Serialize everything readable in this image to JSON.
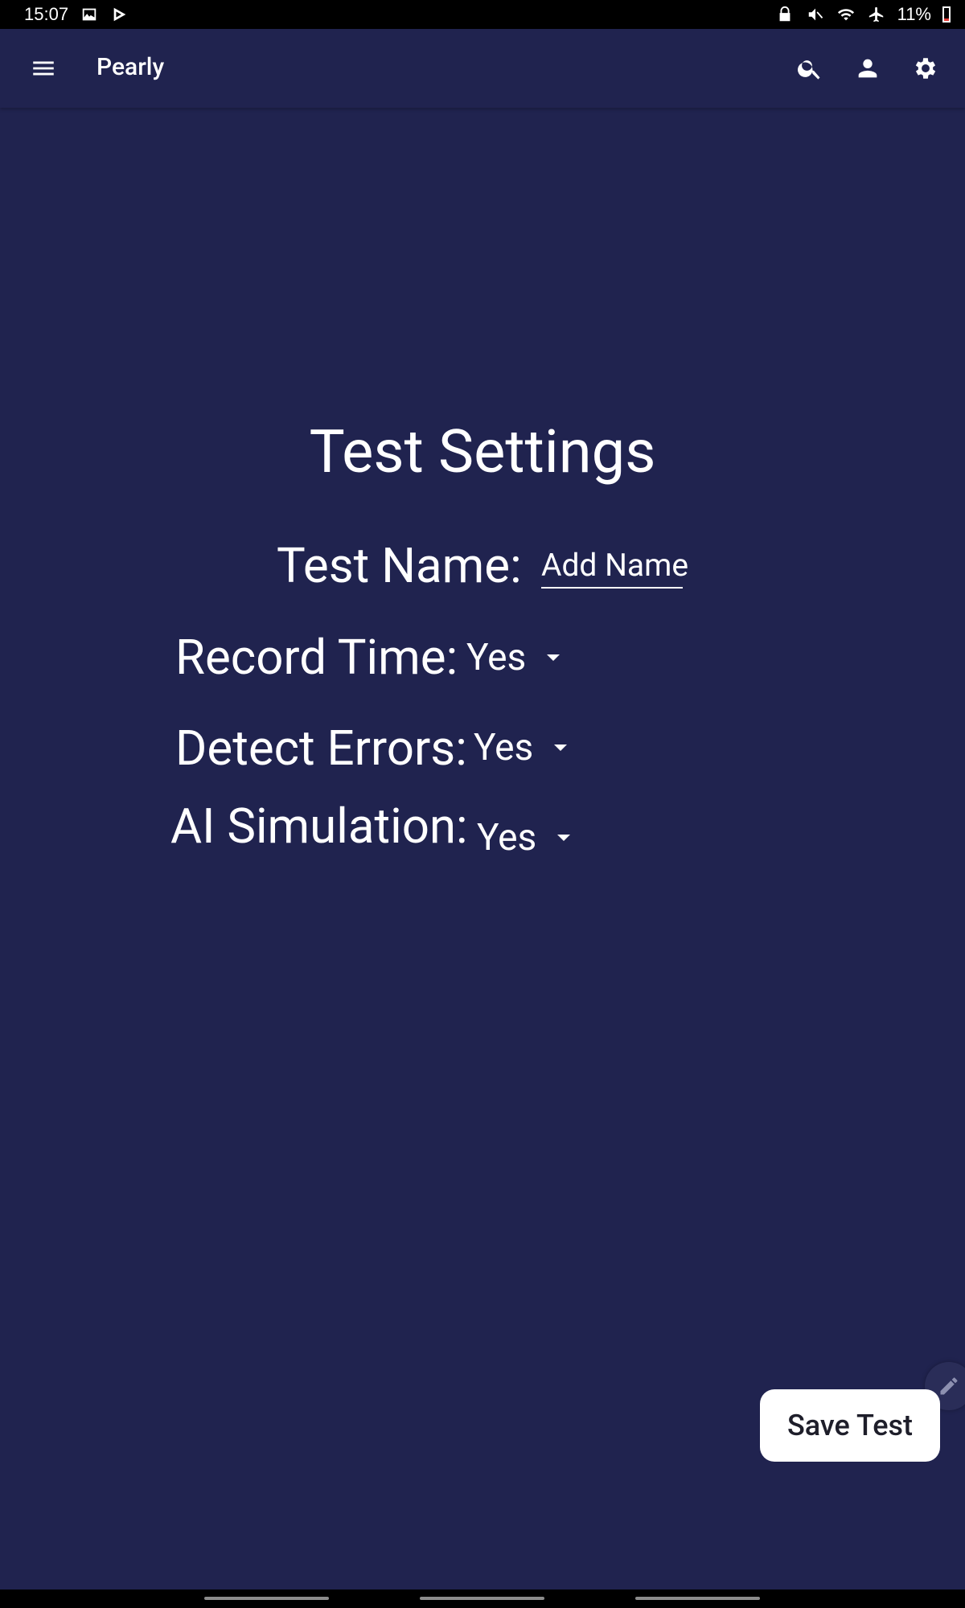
{
  "status_bar": {
    "time": "15:07",
    "left_icons": [
      "image-icon",
      "play-store-icon"
    ],
    "right_icons": [
      "lock-icon",
      "mute-icon",
      "wifi-icon",
      "airplane-icon"
    ],
    "battery": "11%"
  },
  "app_bar": {
    "title": "Pearly",
    "actions": [
      "search-icon",
      "account-icon",
      "settings-icon"
    ]
  },
  "form": {
    "heading": "Test Settings",
    "test_name": {
      "label": "Test Name:",
      "placeholder": "Add Name"
    },
    "record_time": {
      "label": "Record Time:",
      "value": "Yes"
    },
    "detect_errors": {
      "label": "Detect Errors:",
      "value": "Yes"
    },
    "ai_simulation": {
      "label": "AI Simulation:",
      "value": "Yes"
    }
  },
  "actions": {
    "save_label": "Save Test"
  },
  "colors": {
    "background": "#20234f",
    "status_bar": "#000000",
    "button_bg": "#ffffff",
    "text": "#ffffff"
  }
}
